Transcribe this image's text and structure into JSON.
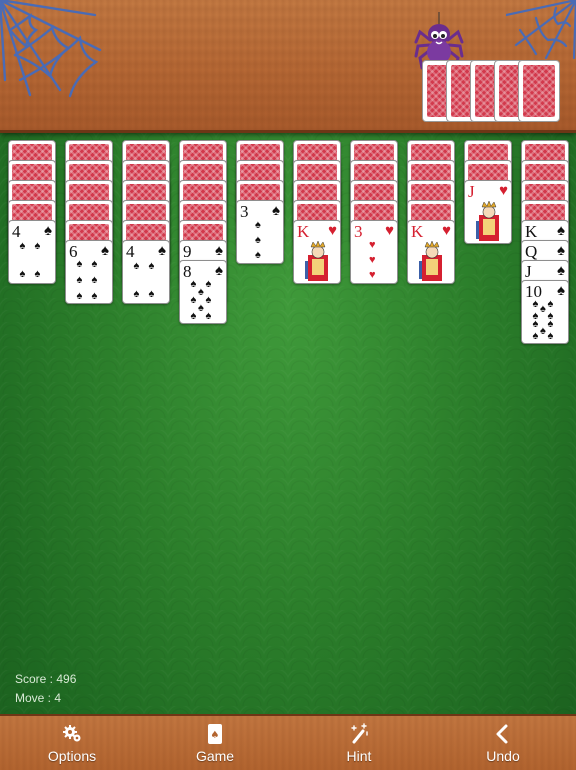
{
  "score": {
    "label": "Score : 496",
    "value": 496,
    "move_label": "Move : 4",
    "moves": 4
  },
  "toolbar": {
    "options_label": "Options",
    "game_label": "Game",
    "hint_label": "Hint",
    "undo_label": "Undo"
  },
  "stock": {
    "remaining_deals": 5
  },
  "tableau": [
    {
      "face_down": 4,
      "face_up": [
        {
          "rank": "4",
          "suit": "♠",
          "color": "black"
        }
      ]
    },
    {
      "face_down": 5,
      "face_up": [
        {
          "rank": "6",
          "suit": "♠",
          "color": "black"
        }
      ]
    },
    {
      "face_down": 5,
      "face_up": [
        {
          "rank": "4",
          "suit": "♠",
          "color": "black"
        }
      ]
    },
    {
      "face_down": 5,
      "face_up": [
        {
          "rank": "9",
          "suit": "♠",
          "color": "black"
        },
        {
          "rank": "8",
          "suit": "♠",
          "color": "black"
        }
      ]
    },
    {
      "face_down": 3,
      "face_up": [
        {
          "rank": "3",
          "suit": "♠",
          "color": "black"
        }
      ]
    },
    {
      "face_down": 4,
      "face_up": [
        {
          "rank": "K",
          "suit": "♥",
          "color": "red"
        }
      ]
    },
    {
      "face_down": 4,
      "face_up": [
        {
          "rank": "3",
          "suit": "♥",
          "color": "red"
        }
      ]
    },
    {
      "face_down": 4,
      "face_up": [
        {
          "rank": "K",
          "suit": "♥",
          "color": "red"
        }
      ]
    },
    {
      "face_down": 2,
      "face_up": [
        {
          "rank": "J",
          "suit": "♥",
          "color": "red"
        }
      ]
    },
    {
      "face_down": 4,
      "face_up": [
        {
          "rank": "K",
          "suit": "♠",
          "color": "black"
        },
        {
          "rank": "Q",
          "suit": "♠",
          "color": "black"
        },
        {
          "rank": "J",
          "suit": "♠",
          "color": "black"
        },
        {
          "rank": "10",
          "suit": "♠",
          "color": "black"
        }
      ]
    }
  ],
  "colors": {
    "felt": "#2c7f2b",
    "wood": "#b86a36",
    "card_back": "#d2394c",
    "red_suit": "#d52030"
  },
  "icons": {
    "options": "gear-icon",
    "game": "card-icon",
    "hint": "magic-wand-icon",
    "undo": "chevron-left-icon"
  }
}
